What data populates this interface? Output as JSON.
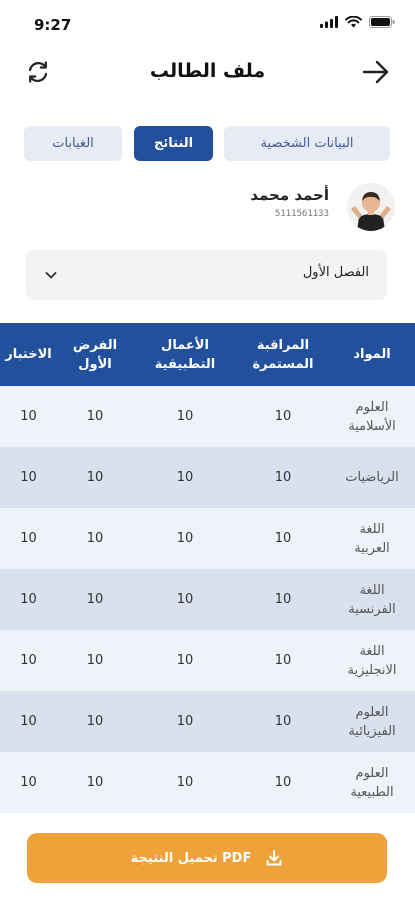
{
  "status_bar": {
    "time": "9:27"
  },
  "header": {
    "title": "ملف الطالب"
  },
  "tabs": [
    {
      "label": "البيانات الشخصية",
      "active": false
    },
    {
      "label": "النتائج",
      "active": true
    },
    {
      "label": "الغيابات",
      "active": false
    }
  ],
  "student": {
    "name": "أحمد محمد",
    "id": "5111561133"
  },
  "term_select": {
    "value": "الفصل الأول"
  },
  "table": {
    "headers": {
      "subject": "المواد",
      "continuous_monitoring": "المراقبة\nالمستمرة",
      "practical_work": "الأعمال\nالتطبيقية",
      "first_assignment": "الفرض\nالأول",
      "exam": "الاختبار"
    },
    "rows": [
      {
        "subject": "العلوم\nالأسلامية",
        "continuous_monitoring": "10",
        "practical_work": "10",
        "first_assignment": "10",
        "exam": "10"
      },
      {
        "subject": "الرياضيات",
        "continuous_monitoring": "10",
        "practical_work": "10",
        "first_assignment": "10",
        "exam": "10"
      },
      {
        "subject": "اللغة\nالعربية",
        "continuous_monitoring": "10",
        "practical_work": "10",
        "first_assignment": "10",
        "exam": "10"
      },
      {
        "subject": "اللغة\nالفرنسية",
        "continuous_monitoring": "10",
        "practical_work": "10",
        "first_assignment": "10",
        "exam": "10"
      },
      {
        "subject": "اللغة\nالانجليزية",
        "continuous_monitoring": "10",
        "practical_work": "10",
        "first_assignment": "10",
        "exam": "10"
      },
      {
        "subject": "العلوم\nالفيزيائية",
        "continuous_monitoring": "10",
        "practical_work": "10",
        "first_assignment": "10",
        "exam": "10"
      },
      {
        "subject": "العلوم\nالطبيعية",
        "continuous_monitoring": "10",
        "practical_work": "10",
        "first_assignment": "10",
        "exam": "10"
      }
    ]
  },
  "download_button": {
    "label": "تحميل النتيجة PDF"
  },
  "colors": {
    "primary": "#22509d",
    "accent": "#efa23a",
    "tab_bg": "#e7ebf4",
    "row_light": "#eef2f9",
    "row_dark": "#d9e1ee"
  },
  "icons": [
    "signal-icon",
    "wifi-icon",
    "battery-icon",
    "arrow-right-icon",
    "refresh-icon",
    "avatar-image",
    "chevron-down-icon",
    "download-icon"
  ]
}
